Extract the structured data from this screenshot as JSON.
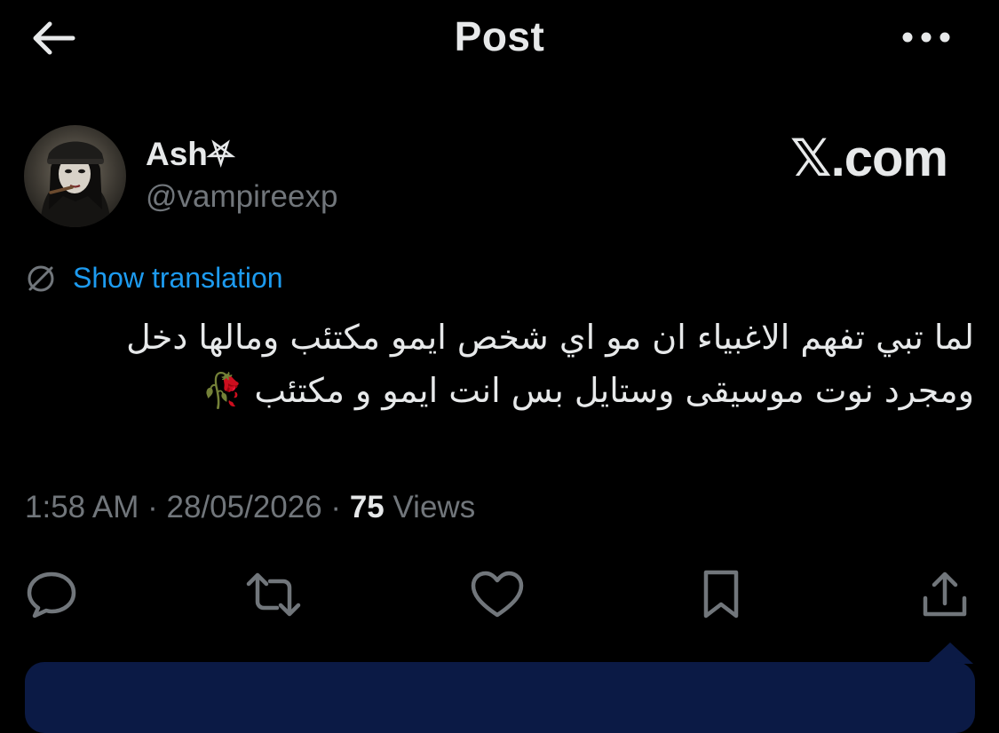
{
  "header": {
    "title": "Post",
    "back_icon": "arrow-left-icon",
    "more_icon": "more-horizontal-icon"
  },
  "author": {
    "display_name": "Ash⛧",
    "handle": "@vampireexp",
    "avatar_icon": "profile-avatar"
  },
  "watermark": "𝕏.com",
  "translation": {
    "label": "Show translation",
    "icon": "globe-icon"
  },
  "tweet": {
    "line1": "لما تبي تفهم الاغبياء ان مو اي شخص ايمو مكتئب ومالها دخل",
    "line2": "ومجرد نوت موسيقى وستايل بس انت ايمو و مكتئب 🥀"
  },
  "meta": {
    "time": "1:58 AM",
    "separator": " · ",
    "date": "28/05/2026",
    "views_count": "75",
    "views_label": " Views"
  },
  "actions": [
    {
      "name": "reply",
      "icon": "reply-icon"
    },
    {
      "name": "repost",
      "icon": "repost-icon"
    },
    {
      "name": "like",
      "icon": "heart-icon"
    },
    {
      "name": "bookmark",
      "icon": "bookmark-icon"
    },
    {
      "name": "share",
      "icon": "share-icon"
    }
  ],
  "colors": {
    "background": "#000000",
    "text_primary": "#e7e9ea",
    "text_secondary": "#71767b",
    "link": "#1d9bf0",
    "banner": "#0b1a45"
  }
}
